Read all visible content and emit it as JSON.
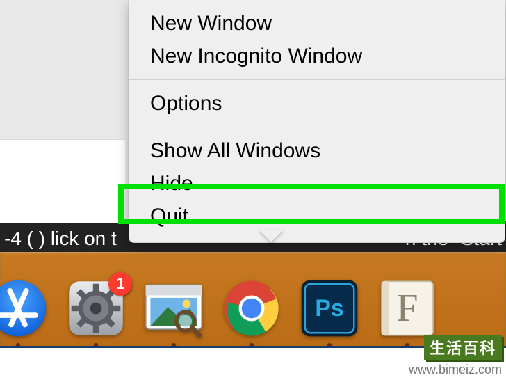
{
  "menu": {
    "items": [
      {
        "label": "New Window"
      },
      {
        "label": "New Incognito Window"
      },
      {
        "label": "Options"
      },
      {
        "label": "Show All Windows"
      },
      {
        "label": "Hide"
      },
      {
        "label": "Quit"
      }
    ],
    "highlighted_index": 5
  },
  "background_text": {
    "left": "-4 (  ) lick on t",
    "right": "n the \"Start"
  },
  "dock": {
    "apps": [
      {
        "name": "App Store",
        "icon": "appstore",
        "badge": null
      },
      {
        "name": "System Preferences",
        "icon": "settings",
        "badge": "1"
      },
      {
        "name": "Photos",
        "icon": "photos",
        "badge": null
      },
      {
        "name": "Chrome",
        "icon": "chrome",
        "badge": null
      },
      {
        "name": "Photoshop",
        "icon": "photoshop",
        "label": "Ps",
        "badge": null
      },
      {
        "name": "Font Book",
        "icon": "fontbook",
        "label": "F",
        "badge": null
      }
    ]
  },
  "watermark": {
    "badge": "生活百科",
    "url": "www.bimeiz.com"
  }
}
